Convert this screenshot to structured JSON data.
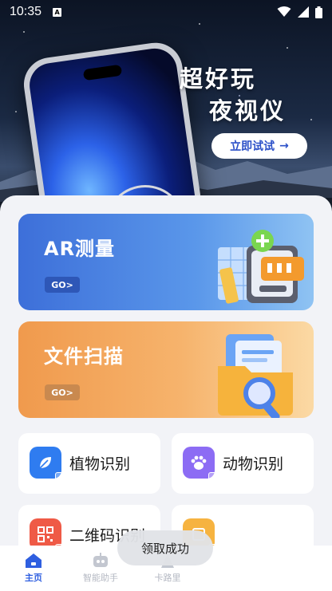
{
  "status_bar": {
    "time": "10:35",
    "notif_icon_letter": "A"
  },
  "hero": {
    "title_line1": "超好玩",
    "title_line2": "夜视仪",
    "cta_label": "立即试试",
    "cta_arrow": "→"
  },
  "feature_cards": [
    {
      "title": "AR测量",
      "badge": "GO>",
      "color": "#4a82e2"
    },
    {
      "title": "文件扫描",
      "badge": "GO>",
      "color": "#f2a35a"
    }
  ],
  "tools": [
    {
      "label": "植物识别",
      "icon": "leaf-icon",
      "color": "#2f7cf0"
    },
    {
      "label": "动物识别",
      "icon": "paw-icon",
      "color": "#8c6cf4"
    },
    {
      "label": "二维码识别",
      "icon": "qr-code-icon",
      "color": "#ef5a46"
    },
    {
      "label": "",
      "icon": "orange-tool-icon",
      "color": "#f6b340"
    }
  ],
  "bottom_nav": [
    {
      "label": "主页",
      "icon": "home-icon",
      "active": true
    },
    {
      "label": "智能助手",
      "icon": "robot-icon",
      "active": false
    },
    {
      "label": "卡路里",
      "icon": "calorie-icon",
      "active": false
    }
  ],
  "toast": {
    "text": "领取成功"
  }
}
